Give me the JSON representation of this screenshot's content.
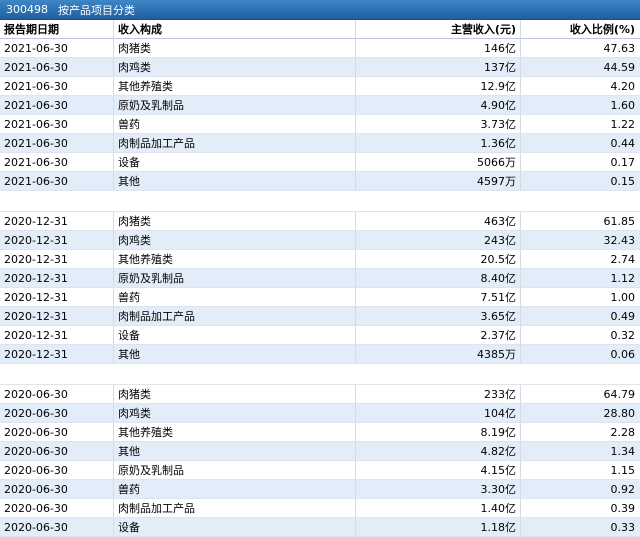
{
  "title": {
    "code": "300498",
    "category": "按产品项目分类"
  },
  "headers": [
    "报告期日期",
    "收入构成",
    "主营收入(元)",
    "收入比例(%)"
  ],
  "groups": [
    {
      "rows": [
        [
          "2021-06-30",
          "肉猪类",
          "146亿",
          "47.63"
        ],
        [
          "2021-06-30",
          "肉鸡类",
          "137亿",
          "44.59"
        ],
        [
          "2021-06-30",
          "其他养殖类",
          "12.9亿",
          "4.20"
        ],
        [
          "2021-06-30",
          "原奶及乳制品",
          "4.90亿",
          "1.60"
        ],
        [
          "2021-06-30",
          "兽药",
          "3.73亿",
          "1.22"
        ],
        [
          "2021-06-30",
          "肉制品加工产品",
          "1.36亿",
          "0.44"
        ],
        [
          "2021-06-30",
          "设备",
          "5066万",
          "0.17"
        ],
        [
          "2021-06-30",
          "其他",
          "4597万",
          "0.15"
        ]
      ]
    },
    {
      "rows": [
        [
          "2020-12-31",
          "肉猪类",
          "463亿",
          "61.85"
        ],
        [
          "2020-12-31",
          "肉鸡类",
          "243亿",
          "32.43"
        ],
        [
          "2020-12-31",
          "其他养殖类",
          "20.5亿",
          "2.74"
        ],
        [
          "2020-12-31",
          "原奶及乳制品",
          "8.40亿",
          "1.12"
        ],
        [
          "2020-12-31",
          "兽药",
          "7.51亿",
          "1.00"
        ],
        [
          "2020-12-31",
          "肉制品加工产品",
          "3.65亿",
          "0.49"
        ],
        [
          "2020-12-31",
          "设备",
          "2.37亿",
          "0.32"
        ],
        [
          "2020-12-31",
          "其他",
          "4385万",
          "0.06"
        ]
      ]
    },
    {
      "rows": [
        [
          "2020-06-30",
          "肉猪类",
          "233亿",
          "64.79"
        ],
        [
          "2020-06-30",
          "肉鸡类",
          "104亿",
          "28.80"
        ],
        [
          "2020-06-30",
          "其他养殖类",
          "8.19亿",
          "2.28"
        ],
        [
          "2020-06-30",
          "其他",
          "4.82亿",
          "1.34"
        ],
        [
          "2020-06-30",
          "原奶及乳制品",
          "4.15亿",
          "1.15"
        ],
        [
          "2020-06-30",
          "兽药",
          "3.30亿",
          "0.92"
        ],
        [
          "2020-06-30",
          "肉制品加工产品",
          "1.40亿",
          "0.39"
        ],
        [
          "2020-06-30",
          "设备",
          "1.18亿",
          "0.33"
        ]
      ]
    }
  ]
}
